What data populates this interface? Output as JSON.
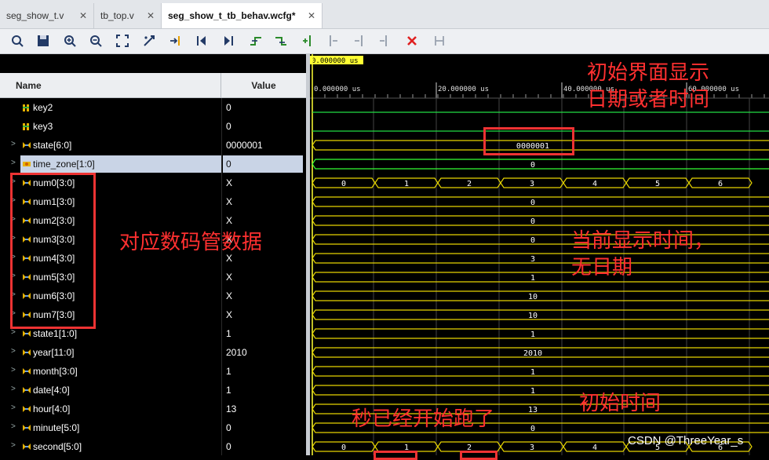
{
  "tabs": [
    {
      "label": "seg_show_t.v",
      "active": false
    },
    {
      "label": "tb_top.v",
      "active": false
    },
    {
      "label": "seg_show_t_tb_behav.wcfg*",
      "active": true
    }
  ],
  "toolbar_icons": [
    "search-icon",
    "save-icon",
    "zoom-in-icon",
    "zoom-out-icon",
    "zoom-fit-icon",
    "swap-cursor-icon",
    "go-to-cursor-icon",
    "go-to-start-icon",
    "go-to-end-icon",
    "previous-transition-icon",
    "next-transition-icon",
    "add-marker-icon",
    "previous-marker-icon",
    "next-marker-icon",
    "delete-marker-icon",
    "delete-icon",
    "snap-icon"
  ],
  "columns": {
    "name": "Name",
    "value": "Value"
  },
  "cursor_time": "0.000000 us",
  "ruler": [
    "0.000000 us",
    "20.000000 us",
    "40.000000 us",
    "60.000000 us"
  ],
  "signals": [
    {
      "name": "key2",
      "value": "0",
      "kind": "bit",
      "expandable": false
    },
    {
      "name": "key3",
      "value": "0",
      "kind": "bit",
      "expandable": false
    },
    {
      "name": "state[6:0]",
      "value": "0000001",
      "kind": "bus",
      "expandable": true,
      "segments": [
        "0000001"
      ]
    },
    {
      "name": "time_zone[1:0]",
      "value": "0",
      "kind": "bus",
      "expandable": true,
      "selected": true,
      "segments": [
        "0"
      ]
    },
    {
      "name": "num0[3:0]",
      "value": "X",
      "kind": "bus",
      "expandable": true,
      "segments": [
        "0",
        "1",
        "2",
        "3",
        "4",
        "5",
        "6"
      ]
    },
    {
      "name": "num1[3:0]",
      "value": "X",
      "kind": "bus",
      "expandable": true,
      "segments": [
        "0"
      ]
    },
    {
      "name": "num2[3:0]",
      "value": "X",
      "kind": "bus",
      "expandable": true,
      "segments": [
        "0"
      ]
    },
    {
      "name": "num3[3:0]",
      "value": "X",
      "kind": "bus",
      "expandable": true,
      "segments": [
        "0"
      ]
    },
    {
      "name": "num4[3:0]",
      "value": "X",
      "kind": "bus",
      "expandable": true,
      "segments": [
        "3"
      ]
    },
    {
      "name": "num5[3:0]",
      "value": "X",
      "kind": "bus",
      "expandable": true,
      "segments": [
        "1"
      ]
    },
    {
      "name": "num6[3:0]",
      "value": "X",
      "kind": "bus",
      "expandable": true,
      "segments": [
        "10"
      ]
    },
    {
      "name": "num7[3:0]",
      "value": "X",
      "kind": "bus",
      "expandable": true,
      "segments": [
        "10"
      ]
    },
    {
      "name": "state1[1:0]",
      "value": "1",
      "kind": "bus",
      "expandable": true,
      "segments": [
        "1"
      ]
    },
    {
      "name": "year[11:0]",
      "value": "2010",
      "kind": "bus",
      "expandable": true,
      "segments": [
        "2010"
      ]
    },
    {
      "name": "month[3:0]",
      "value": "1",
      "kind": "bus",
      "expandable": true,
      "segments": [
        "1"
      ]
    },
    {
      "name": "date[4:0]",
      "value": "1",
      "kind": "bus",
      "expandable": true,
      "segments": [
        "1"
      ]
    },
    {
      "name": "hour[4:0]",
      "value": "13",
      "kind": "bus",
      "expandable": true,
      "segments": [
        "13"
      ]
    },
    {
      "name": "minute[5:0]",
      "value": "0",
      "kind": "bus",
      "expandable": true,
      "segments": [
        "0"
      ]
    },
    {
      "name": "second[5:0]",
      "value": "0",
      "kind": "bus",
      "expandable": true,
      "segments": [
        "0",
        "1",
        "2",
        "3",
        "4",
        "5",
        "6"
      ]
    }
  ],
  "annotations": {
    "initial_display": "初始界面显示\n日期或者时间",
    "num_data": "对应数码管数据",
    "current_time": "当前显示时间，\n无日期",
    "initial_time": "初始时间",
    "seconds_running": "秒已经开始跑了"
  },
  "watermark": "CSDN @ThreeYear_s",
  "colors": {
    "bus": "#e6d400",
    "bit": "#22dd44",
    "selected_bus": "#33ff33",
    "annotation": "#ff3030",
    "cursor": "#ffff33"
  }
}
